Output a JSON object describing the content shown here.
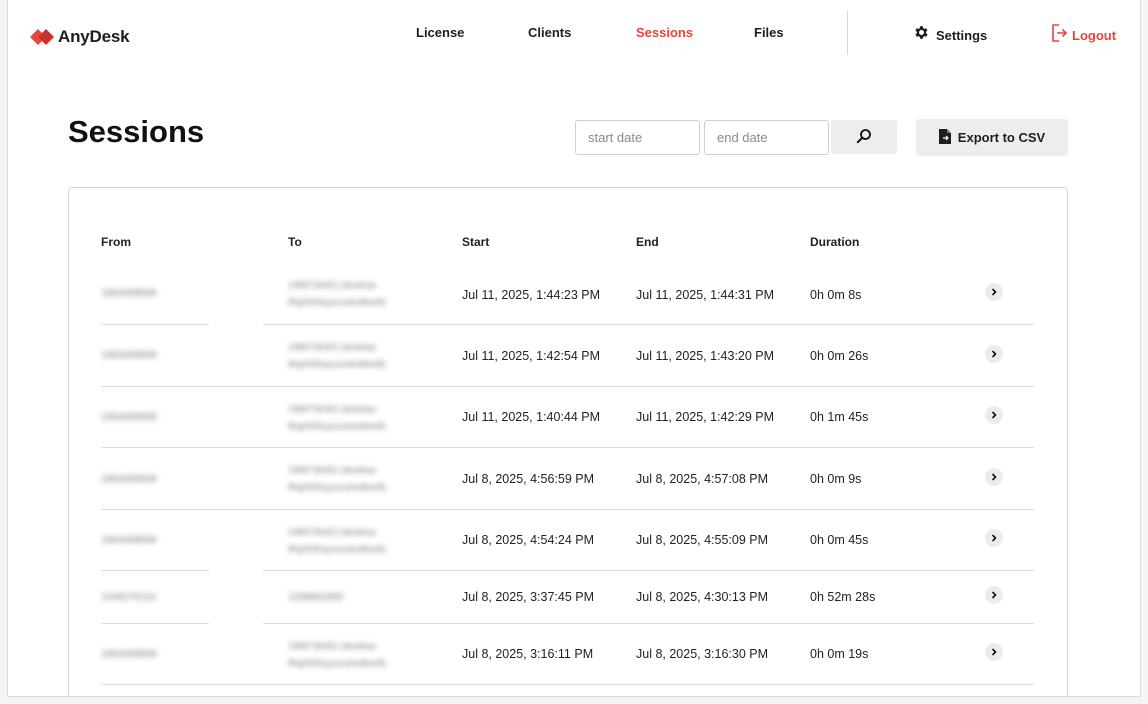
{
  "brand": {
    "name": "AnyDesk",
    "accent": "#e0483a"
  },
  "nav": {
    "license": "License",
    "clients": "Clients",
    "sessions": "Sessions",
    "files": "Files",
    "settings": "Settings",
    "logout": "Logout",
    "active": "Sessions"
  },
  "page": {
    "title": "Sessions"
  },
  "filter": {
    "start_placeholder": "start date",
    "end_placeholder": "end date",
    "search_icon": "search-icon",
    "export_label": "Export to CSV"
  },
  "table": {
    "columns": [
      "From",
      "To",
      "Start",
      "End",
      "Duration"
    ],
    "rows": [
      {
        "from": "1963408508",
        "to_line1": "1986736452 (desktop-",
        "to_line2": "8hg093hyyuzudna8ws8)",
        "start": "Jul 11, 2025, 1:44:23 PM",
        "end": "Jul 11, 2025, 1:44:31 PM",
        "duration": "0h 0m 8s"
      },
      {
        "from": "1963408508",
        "to_line1": "1986736452 (desktop-",
        "to_line2": "8hg093hyyuzudna8ws8)",
        "start": "Jul 11, 2025, 1:42:54 PM",
        "end": "Jul 11, 2025, 1:43:20 PM",
        "duration": "0h 0m 26s"
      },
      {
        "from": "1963408508",
        "to_line1": "1986736452 (desktop-",
        "to_line2": "8hg093hyyuzudna8ws8)",
        "start": "Jul 11, 2025, 1:40:44 PM",
        "end": "Jul 11, 2025, 1:42:29 PM",
        "duration": "0h 1m 45s"
      },
      {
        "from": "1963408508",
        "to_line1": "1986736452 (desktop-",
        "to_line2": "8hg093hyyuzudna8ws8)",
        "start": "Jul 8, 2025, 4:56:59 PM",
        "end": "Jul 8, 2025, 4:57:08 PM",
        "duration": "0h 0m 9s"
      },
      {
        "from": "1963408508",
        "to_line1": "1986736452 (desktop-",
        "to_line2": "8hg093hyyuzudna8ws8)",
        "start": "Jul 8, 2025, 4:54:24 PM",
        "end": "Jul 8, 2025, 4:55:09 PM",
        "duration": "0h 0m 45s"
      },
      {
        "from": "1049275114",
        "to_line1": "1269662692",
        "to_line2": "",
        "start": "Jul 8, 2025, 3:37:45 PM",
        "end": "Jul 8, 2025, 4:30:13 PM",
        "duration": "0h 52m 28s"
      },
      {
        "from": "1963408508",
        "to_line1": "1986736452 (desktop-",
        "to_line2": "8hg093hyyuzudna8ws8)",
        "start": "Jul 8, 2025, 3:16:11 PM",
        "end": "Jul 8, 2025, 3:16:30 PM",
        "duration": "0h 0m 19s"
      }
    ]
  }
}
